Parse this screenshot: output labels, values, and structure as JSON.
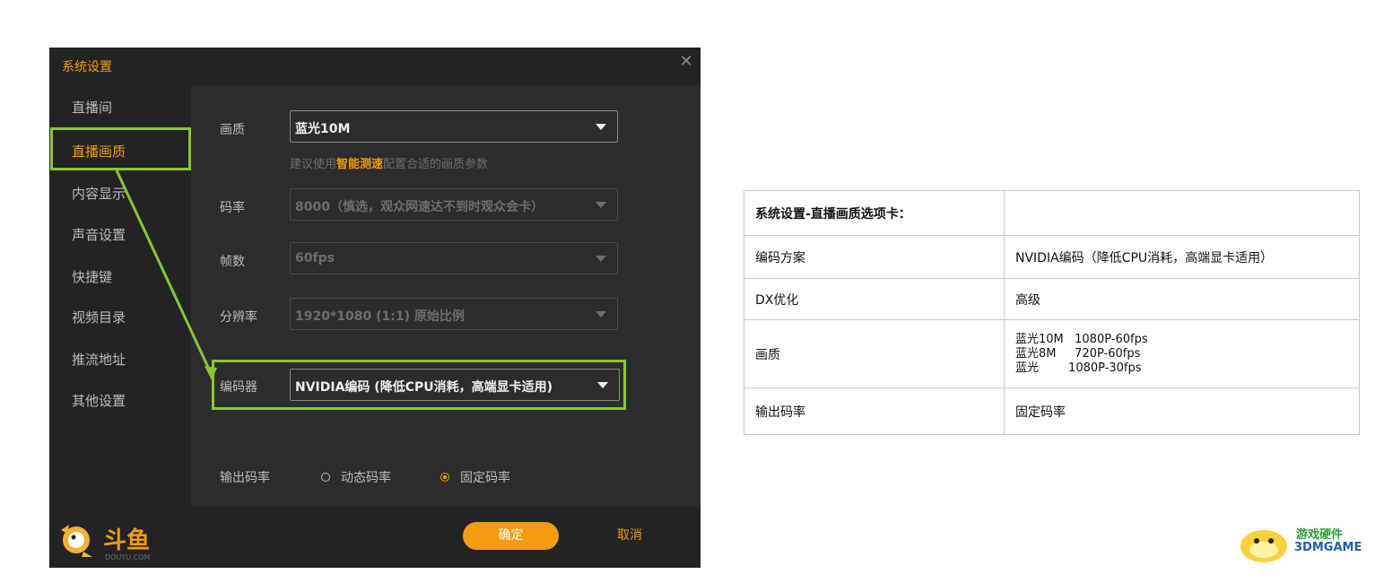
{
  "dialog": {
    "title": "系统设置",
    "close_glyph": "✕"
  },
  "sidebar": {
    "items": [
      {
        "label": "直播间"
      },
      {
        "label": "直播画质",
        "active": true
      },
      {
        "label": "内容显示"
      },
      {
        "label": "声音设置"
      },
      {
        "label": "快捷键"
      },
      {
        "label": "视频目录"
      },
      {
        "label": "推流地址"
      },
      {
        "label": "其他设置"
      }
    ]
  },
  "settings": {
    "quality": {
      "label": "画质",
      "value": "蓝光10M"
    },
    "hint": {
      "prefix": "建议使用",
      "link": "智能测速",
      "suffix": "配置合适的画质参数"
    },
    "bitrate": {
      "label": "码率",
      "value": "8000（慎选，观众网速达不到时观众会卡）"
    },
    "fps": {
      "label": "帧数",
      "value": "60fps"
    },
    "resolution": {
      "label": "分辨率",
      "value": "1920*1080 (1:1) 原始比例"
    },
    "encoder": {
      "label": "编码器",
      "value": "NVIDIA编码 (降低CPU消耗，高端显卡适用)"
    },
    "output_bitrate": {
      "label": "输出码率",
      "options": [
        {
          "label": "动态码率",
          "checked": false
        },
        {
          "label": "固定码率",
          "checked": true
        }
      ]
    }
  },
  "footer": {
    "ok_label": "确定",
    "cancel_label": "取消",
    "logo_text": "斗鱼",
    "logo_sub": "DOUYU.COM"
  },
  "table": {
    "header": "系统设置-直播画质选项卡：",
    "rows": [
      {
        "key": "编码方案",
        "value": "NVIDIA编码（降低CPU消耗，高端显卡适用）"
      },
      {
        "key": "DX优化",
        "value": "高级"
      },
      {
        "key": "画质",
        "lines": [
          "蓝光10M   1080P-60fps",
          "蓝光8M     720P-60fps",
          "蓝光        1080P-30fps"
        ]
      },
      {
        "key": "输出码率",
        "value": "固定码率"
      }
    ]
  },
  "watermark": {
    "line1": "游戏硬件",
    "line2": "3DMGAME"
  },
  "colors": {
    "accent": "#f39c12",
    "highlight": "#8bc532",
    "dialog_bg": "#2c2c2e",
    "panel_bg": "#232325"
  }
}
